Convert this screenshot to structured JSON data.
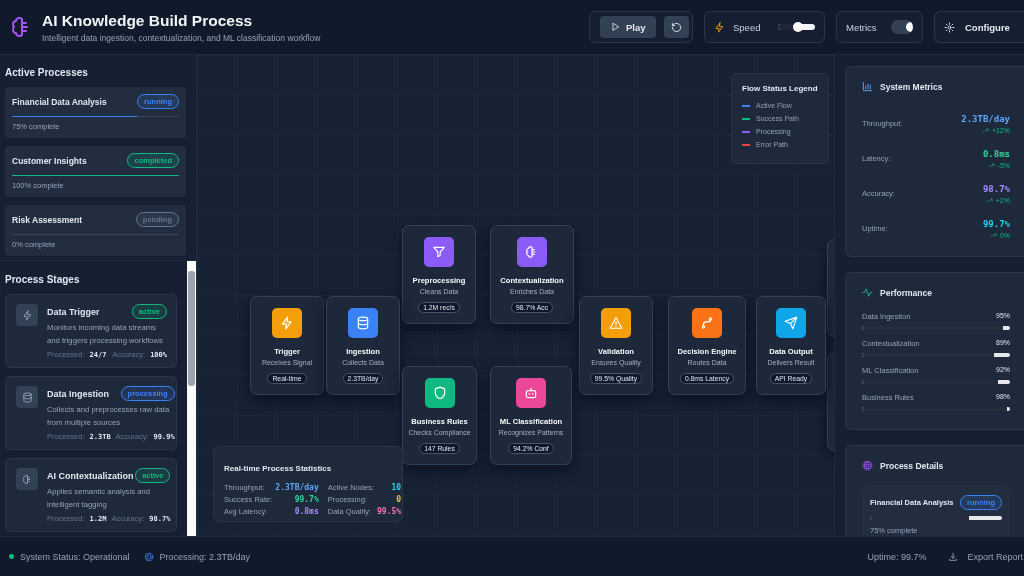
{
  "header": {
    "title": "AI Knowledge Build Process",
    "subtitle": "Intelligent data ingestion, contextualization, and ML classification workflow",
    "play_label": "Play",
    "speed": {
      "label": "Speed",
      "level": 0.45
    },
    "metrics_toggle": {
      "label": "Metrics",
      "on": true
    },
    "configure_label": "Configure"
  },
  "active_processes": {
    "title": "Active Processes",
    "items": [
      {
        "name": "Financial Data Analysis",
        "status": "running",
        "color": "#3b82f6",
        "level": 0.75,
        "progress": "75% complete"
      },
      {
        "name": "Customer Insights",
        "status": "completed",
        "color": "#10b981",
        "level": 1,
        "progress": "100% complete"
      },
      {
        "name": "Risk Assessment",
        "status": "pending",
        "color": "#64748b",
        "level": 0,
        "progress": "0% complete"
      }
    ]
  },
  "process_stages": {
    "title": "Process Stages",
    "items": [
      {
        "name": "Data Trigger",
        "status": "active",
        "color": "#10b981",
        "description": "Monitors incoming data streams and triggers processing workflows",
        "processed_label": "Processed:",
        "processed": "24/7",
        "accuracy_label": "Accuracy:",
        "accuracy": "100%"
      },
      {
        "name": "Data Ingestion",
        "status": "processing",
        "color": "#3b82f6",
        "description": "Collects and preprocesses raw data from multiple sources",
        "processed_label": "Processed:",
        "processed": "2.3TB",
        "accuracy_label": "Accuracy:",
        "accuracy": "99.9%"
      },
      {
        "name": "AI Contextualization",
        "status": "active",
        "color": "#10b981",
        "description": "Applies semantic analysis and intelligent tagging",
        "processed_label": "Processed:",
        "processed": "1.2M",
        "accuracy_label": "Accuracy:",
        "accuracy": "98.7%"
      }
    ]
  },
  "flow": {
    "legend": {
      "title": "Flow Status Legend",
      "items": [
        {
          "label": "Active Flow",
          "color": "#3b82f6"
        },
        {
          "label": "Success Path",
          "color": "#10b981"
        },
        {
          "label": "Processing",
          "color": "#8b5cf6"
        },
        {
          "label": "Error Path",
          "color": "#ef4444"
        }
      ]
    },
    "nodes": [
      {
        "name": "Preprocessing",
        "subtitle": "Cleans Data",
        "tag": "1.2M rec/s",
        "color": "#8b5cf6"
      },
      {
        "name": "Contextualization",
        "subtitle": "Enriches Data",
        "tag": "98.7% Acc",
        "color": "#8b5cf6"
      },
      {
        "name": "Trigger",
        "subtitle": "Receives Signal",
        "tag": "Real-time",
        "color": "#f59e0b"
      },
      {
        "name": "Ingestion",
        "subtitle": "Collects Data",
        "tag": "2.3TB/day",
        "color": "#3b82f6"
      },
      {
        "name": "Validation",
        "subtitle": "Ensures Quality",
        "tag": "99.5% Quality",
        "color": "#f59e0b"
      },
      {
        "name": "Decision Engine",
        "subtitle": "Routes Data",
        "tag": "0.8ms Latency",
        "color": "#f97316"
      },
      {
        "name": "Data Output",
        "subtitle": "Delivers Result",
        "tag": "API Ready",
        "color": "#0ea5e9"
      },
      {
        "name": "Business Rules",
        "subtitle": "Checks Compliance",
        "tag": "147 Rules",
        "color": "#10b981"
      },
      {
        "name": "ML Classification",
        "subtitle": "Recognizes Patterns",
        "tag": "94.2% Conf",
        "color": "#ec4899"
      }
    ],
    "stats": {
      "title": "Real-time Process Statistics",
      "items": [
        {
          "label": "Throughput:",
          "value": "2.3TB/day",
          "color": "#60a5fa"
        },
        {
          "label": "Active Nodes:",
          "value": "10",
          "color": "#22d3ee"
        },
        {
          "label": "Success Rate:",
          "value": "99.7%",
          "color": "#34d399"
        },
        {
          "label": "Processing:",
          "value": "0",
          "color": "#fbbf24"
        },
        {
          "label": "Avg Latency:",
          "value": "0.8ms",
          "color": "#a78bfa"
        },
        {
          "label": "Data Quality:",
          "value": "99.5%",
          "color": "#f472b6"
        }
      ]
    }
  },
  "system_metrics": {
    "title": "System Metrics",
    "items": [
      {
        "label": "Throughput:",
        "value": "2.3TB/day",
        "color": "#60a5fa",
        "change": "+12%"
      },
      {
        "label": "Latency:",
        "value": "0.8ms",
        "color": "#34d399",
        "change": "-5%"
      },
      {
        "label": "Accuracy:",
        "value": "98.7%",
        "color": "#a78bfa",
        "change": "+2%"
      },
      {
        "label": "Uptime:",
        "value": "99.7%",
        "color": "#22d3ee",
        "change": "0%"
      }
    ]
  },
  "performance": {
    "title": "Performance",
    "items": [
      {
        "label": "Data Ingestion",
        "value": "95%",
        "level": 0.95
      },
      {
        "label": "Contextualization",
        "value": "89%",
        "level": 0.89
      },
      {
        "label": "ML Classification",
        "value": "92%",
        "level": 0.92
      },
      {
        "label": "Business Rules",
        "value": "98%",
        "level": 0.98
      }
    ]
  },
  "process_details": {
    "title": "Process Details",
    "item": {
      "name": "Financial Data Analysis",
      "status": "running",
      "color": "#3b82f6",
      "level": 0.75,
      "progress": "75% complete"
    }
  },
  "status_bar": {
    "status": "System Status: Operational",
    "processing": "Processing: 2.3TB/day",
    "uptime": "Uptime: 99.7%",
    "export": "Export Report"
  }
}
